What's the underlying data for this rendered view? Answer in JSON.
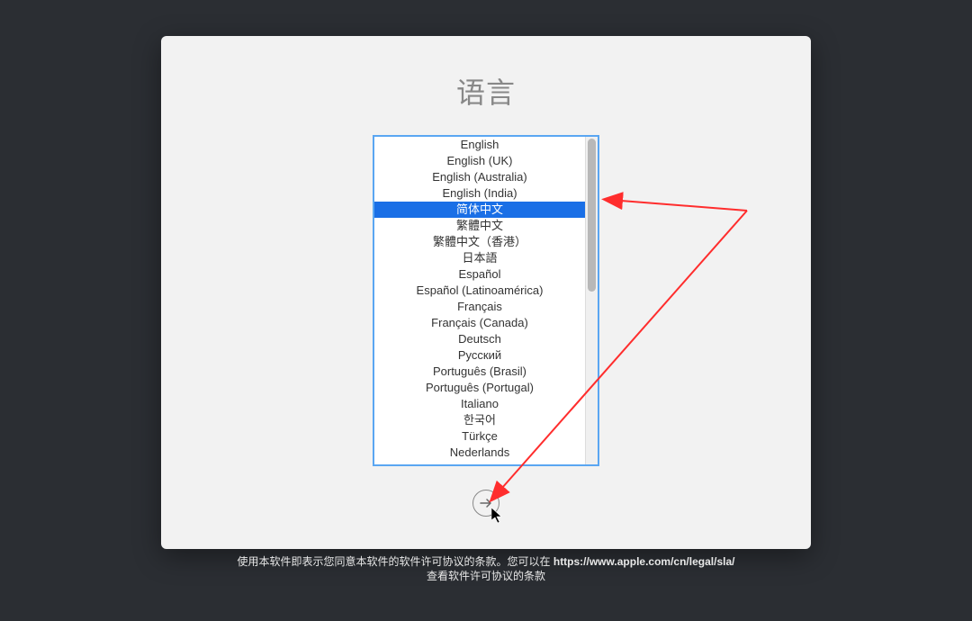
{
  "title": "语言",
  "selectedIndex": 4,
  "languages": [
    "English",
    "English (UK)",
    "English (Australia)",
    "English (India)",
    "简体中文",
    "繁體中文",
    "繁體中文（香港）",
    "日本語",
    "Español",
    "Español (Latinoamérica)",
    "Français",
    "Français (Canada)",
    "Deutsch",
    "Русский",
    "Português (Brasil)",
    "Português (Portugal)",
    "Italiano",
    "한국어",
    "Türkçe",
    "Nederlands"
  ],
  "footer": {
    "line1_prefix": "使用本软件即表示您同意本软件的软件许可协议的条款。您可以在 ",
    "url": "https://www.apple.com/cn/legal/sla/",
    "line2": "查看软件许可协议的条款"
  }
}
